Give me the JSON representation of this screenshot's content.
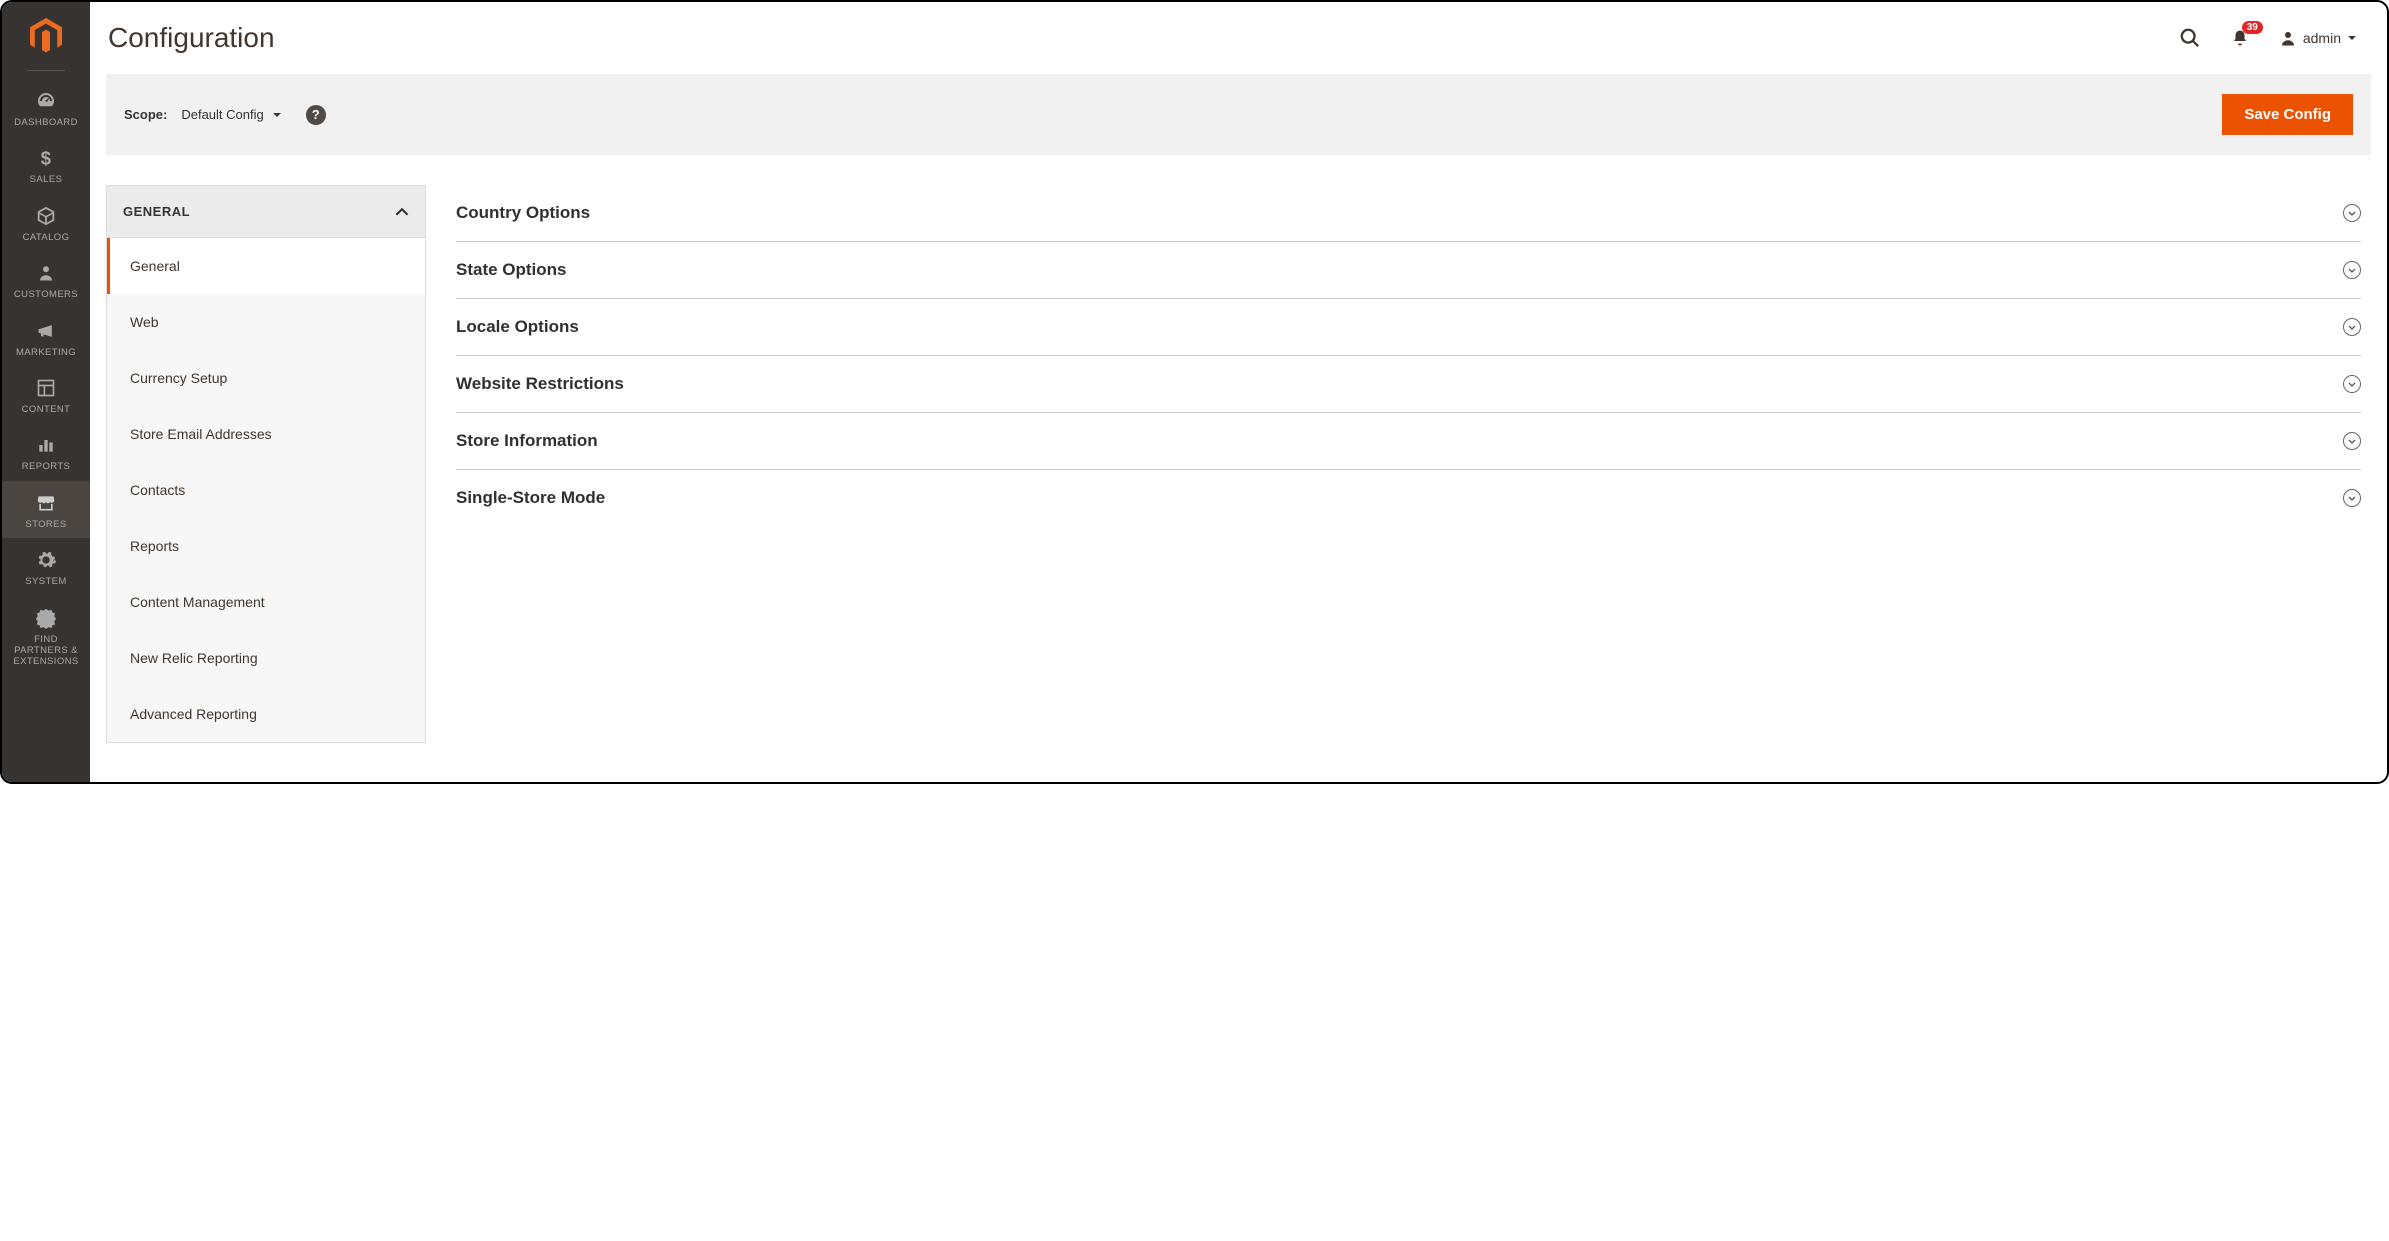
{
  "header": {
    "page_title": "Configuration",
    "notification_count": "39",
    "user_name": "admin"
  },
  "toolbar": {
    "scope_label": "Scope:",
    "scope_value": "Default Config",
    "save_label": "Save Config"
  },
  "sidebar": {
    "items": [
      {
        "label": "DASHBOARD"
      },
      {
        "label": "SALES"
      },
      {
        "label": "CATALOG"
      },
      {
        "label": "CUSTOMERS"
      },
      {
        "label": "MARKETING"
      },
      {
        "label": "CONTENT"
      },
      {
        "label": "REPORTS"
      },
      {
        "label": "STORES"
      },
      {
        "label": "SYSTEM"
      },
      {
        "label": "FIND PARTNERS & EXTENSIONS"
      }
    ]
  },
  "config_nav": {
    "group_label": "GENERAL",
    "items": [
      {
        "label": "General"
      },
      {
        "label": "Web"
      },
      {
        "label": "Currency Setup"
      },
      {
        "label": "Store Email Addresses"
      },
      {
        "label": "Contacts"
      },
      {
        "label": "Reports"
      },
      {
        "label": "Content Management"
      },
      {
        "label": "New Relic Reporting"
      },
      {
        "label": "Advanced Reporting"
      }
    ]
  },
  "sections": [
    {
      "title": "Country Options"
    },
    {
      "title": "State Options"
    },
    {
      "title": "Locale Options"
    },
    {
      "title": "Website Restrictions"
    },
    {
      "title": "Store Information"
    },
    {
      "title": "Single-Store Mode"
    }
  ]
}
